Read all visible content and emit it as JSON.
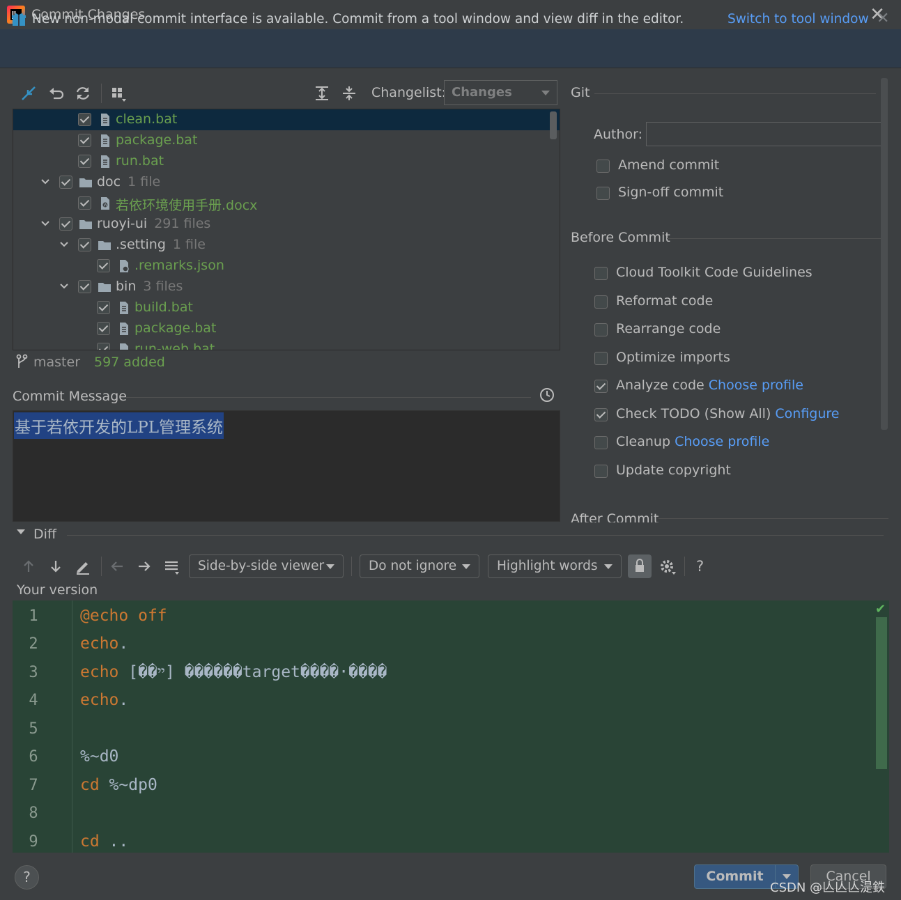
{
  "window": {
    "title": "Commit Changes",
    "app_icon": "intellij-icon"
  },
  "banner": {
    "text": "New non-modal commit interface is available. Commit from a tool window and view diff in the editor.",
    "link": "Switch to tool window"
  },
  "changes_toolbar": {
    "changelist_label": "Changelist:",
    "changelist_value": "Changes"
  },
  "tree": {
    "rows": [
      {
        "label": "clean.bat",
        "count": ""
      },
      {
        "label": "package.bat",
        "count": ""
      },
      {
        "label": "run.bat",
        "count": ""
      },
      {
        "label": "doc",
        "count": "1 file"
      },
      {
        "label": "若依环境使用手册.docx",
        "count": ""
      },
      {
        "label": "ruoyi-ui",
        "count": "291 files"
      },
      {
        "label": ".setting",
        "count": "1 file"
      },
      {
        "label": ".remarks.json",
        "count": ""
      },
      {
        "label": "bin",
        "count": "3 files"
      },
      {
        "label": "build.bat",
        "count": ""
      },
      {
        "label": "package.bat",
        "count": ""
      },
      {
        "label": "run-web.bat",
        "count": ""
      }
    ]
  },
  "status": {
    "branch": "master",
    "added": "597 added"
  },
  "commit_message": {
    "label": "Commit Message",
    "text": "基于若依开发的LPL管理系统"
  },
  "git": {
    "section": "Git",
    "author_label": "Author:",
    "author_value": "",
    "amend": "Amend commit",
    "signoff": "Sign-off commit"
  },
  "before_commit": {
    "section": "Before Commit",
    "options": [
      {
        "label": "Cloud Toolkit Code Guidelines",
        "link": "",
        "checked": false
      },
      {
        "label": "Reformat code",
        "link": "",
        "checked": false
      },
      {
        "label": "Rearrange code",
        "link": "",
        "checked": false
      },
      {
        "label": "Optimize imports",
        "link": "",
        "checked": false
      },
      {
        "label": "Analyze code",
        "link": "Choose profile",
        "checked": true
      },
      {
        "label": "Check TODO (Show All)",
        "link": "Configure",
        "checked": true
      },
      {
        "label": "Cleanup",
        "link": "Choose profile",
        "checked": false
      },
      {
        "label": "Update copyright",
        "link": "",
        "checked": false
      }
    ]
  },
  "after_commit": {
    "section": "After Commit"
  },
  "diff": {
    "label": "Diff",
    "viewer": "Side-by-side viewer",
    "ignore": "Do not ignore",
    "highlight": "Highlight words",
    "help": "?",
    "your_version": "Your version",
    "lines": [
      {
        "n": "1",
        "kw": "@echo",
        "rest": " off"
      },
      {
        "n": "2",
        "kw": "echo",
        "rest": "."
      },
      {
        "n": "3",
        "kw": "echo",
        "rest": " [��ײ] ������target����·����"
      },
      {
        "n": "4",
        "kw": "echo",
        "rest": "."
      },
      {
        "n": "5",
        "kw": "",
        "rest": ""
      },
      {
        "n": "6",
        "kw": "",
        "rest": "%~d0"
      },
      {
        "n": "7",
        "kw": "cd",
        "rest": " %~dp0"
      },
      {
        "n": "8",
        "kw": "",
        "rest": ""
      },
      {
        "n": "9",
        "kw": "cd",
        "rest": " .."
      }
    ]
  },
  "buttons": {
    "help": "?",
    "commit": "Commit",
    "cancel": "Cancel"
  },
  "watermark": "CSDN @亾亾亾湜鉄",
  "colors": {
    "accent": "#589df6",
    "added_green": "#6a9f4f",
    "selection": "#214283",
    "keyword": "#cc7832"
  }
}
